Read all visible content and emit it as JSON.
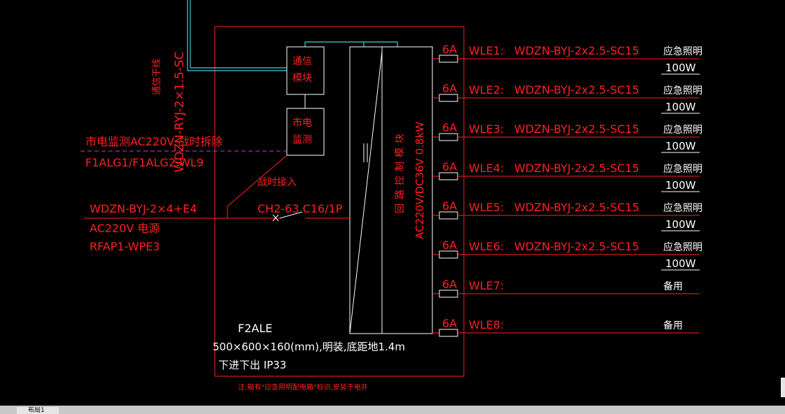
{
  "colors": {
    "background": "#000000",
    "red": "#ff2020",
    "cyan": "#3fd2d2",
    "white": "#ffffff",
    "magenta": "#c63ccf",
    "gray": "#9a9a9a"
  },
  "left": {
    "vertical_cable": "WDZN-RYJ-2×1.5-SC",
    "comm_trunk": "通信干线",
    "mains_monitor": "市电监测AC220V 战时拆除",
    "mains_monitor_ref": "F1ALG1/F1ALG2-WL9",
    "wartime": "战时接入",
    "supply_cable": "WDZN-BYJ-2×4+E4",
    "supply_power": "AC220V 电源",
    "supply_ref": "RFAP1-WPE3",
    "breaker": "CH2-63 C16/1P"
  },
  "modules": {
    "comm_line1": "通信",
    "comm_line2": "模块",
    "mains_line1": "市电",
    "mains_line2": "监测"
  },
  "controller": {
    "name": "回路控制模块",
    "voltage": "AC220V/DC36V   0.8kW"
  },
  "circuits": [
    {
      "breaker": "6A",
      "id": "WLE1:",
      "cable": "WDZN-BYJ-2x2.5-SC15",
      "use": "应急照明",
      "power": "100W"
    },
    {
      "breaker": "6A",
      "id": "WLE2:",
      "cable": "WDZN-BYJ-2x2.5-SC15",
      "use": "应急照明",
      "power": "100W"
    },
    {
      "breaker": "6A",
      "id": "WLE3:",
      "cable": "WDZN-BYJ-2x2.5-SC15",
      "use": "应急照明",
      "power": "100W"
    },
    {
      "breaker": "6A",
      "id": "WLE4:",
      "cable": "WDZN-BYJ-2x2.5-SC15",
      "use": "应急照明",
      "power": "100W"
    },
    {
      "breaker": "6A",
      "id": "WLE5:",
      "cable": "WDZN-BYJ-2x2.5-SC15",
      "use": "应急照明",
      "power": "100W"
    },
    {
      "breaker": "6A",
      "id": "WLE6:",
      "cable": "WDZN-BYJ-2x2.5-SC15",
      "use": "应急照明",
      "power": "100W"
    },
    {
      "breaker": "6A",
      "id": "WLE7:",
      "cable": "",
      "use": "备用",
      "power": ""
    },
    {
      "breaker": "6A",
      "id": "WLE8:",
      "cable": "",
      "use": "备用",
      "power": ""
    }
  ],
  "panel": {
    "name": "F2ALE",
    "spec": "500×600×160(mm),明装,底距地1.4m",
    "entry": "下进下出   IP33"
  },
  "note": "注:箱有\"应急照明配电箱\"标识,安装于电井",
  "tab_label": "布局1"
}
